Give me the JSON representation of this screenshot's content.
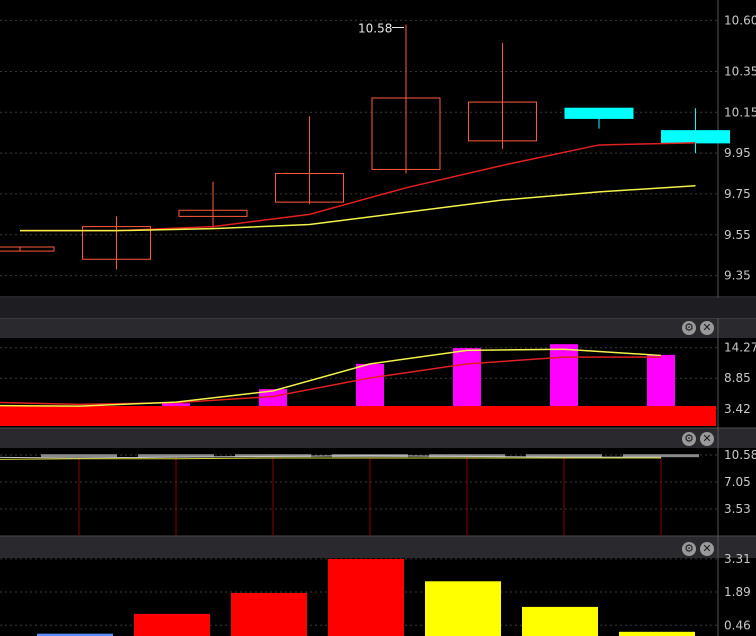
{
  "chart_data": [
    {
      "type": "candlestick",
      "ylim": [
        9.25,
        10.7
      ],
      "y_ticks": [
        "10.60",
        "10.35",
        "10.15",
        "9.95",
        "9.75",
        "9.55",
        "9.35"
      ],
      "y_tick_values": [
        10.6,
        10.35,
        10.15,
        9.95,
        9.75,
        9.55,
        9.35
      ],
      "candles": [
        {
          "open": 9.47,
          "close": 9.49,
          "high": 9.49,
          "low": 9.47,
          "color": "#ff5a3c",
          "filled": false
        },
        {
          "open": 9.43,
          "close": 9.59,
          "high": 9.64,
          "low": 9.38,
          "color": "#ff5a3c",
          "filled": false
        },
        {
          "open": 9.64,
          "close": 9.67,
          "high": 9.81,
          "low": 9.58,
          "color": "#ff5a3c",
          "filled": false
        },
        {
          "open": 9.71,
          "close": 9.85,
          "high": 10.13,
          "low": 9.7,
          "color": "#ff5a3c",
          "filled": false
        },
        {
          "open": 9.87,
          "close": 10.22,
          "high": 10.58,
          "low": 9.85,
          "color": "#ff5a3c",
          "filled": false
        },
        {
          "open": 10.01,
          "close": 10.2,
          "high": 10.49,
          "low": 9.97,
          "color": "#ff5a3c",
          "filled": false
        },
        {
          "open": 10.17,
          "close": 10.12,
          "high": 10.17,
          "low": 10.07,
          "color": "#00ffff",
          "filled": true
        },
        {
          "open": 10.06,
          "close": 10.0,
          "high": 10.17,
          "low": 9.95,
          "color": "#00ffff",
          "filled": true
        }
      ],
      "series": [
        {
          "color": "#e02020",
          "values": [
            9.57,
            9.57,
            9.59,
            9.65,
            9.78,
            9.89,
            9.99,
            10.0
          ]
        },
        {
          "color": "#f2f24a",
          "values": [
            9.57,
            9.57,
            9.58,
            9.6,
            9.66,
            9.72,
            9.76,
            9.79
          ]
        }
      ],
      "annotations": [
        {
          "text": "10.58",
          "at_candle": 4,
          "value": 10.58
        }
      ]
    },
    {
      "type": "bar",
      "ylim": [
        0,
        16
      ],
      "y_ticks": [
        "14.27",
        "8.85",
        "3.42"
      ],
      "y_tick_values": [
        14.27,
        8.85,
        3.42
      ],
      "values": [
        3.6,
        4.4,
        6.9,
        11.4,
        14.2,
        14.9,
        13.0
      ],
      "bar_color": "#ff00ff",
      "baseline_color": "#ff0000",
      "series": [
        {
          "color": "#e02020",
          "values": [
            4.6,
            4.2,
            4.5,
            5.6,
            8.9,
            11.4,
            12.6,
            12.6
          ]
        },
        {
          "color": "#f2f24a",
          "values": [
            4.0,
            3.9,
            4.6,
            6.6,
            11.4,
            13.8,
            14.0,
            12.9
          ]
        }
      ]
    },
    {
      "type": "bar",
      "ylim": [
        0,
        11.5
      ],
      "y_ticks": [
        "10.58",
        "7.05",
        "3.53"
      ],
      "y_tick_values": [
        10.58,
        7.05,
        3.53
      ],
      "values": [
        10.3,
        10.3,
        10.3,
        10.3,
        10.3,
        10.3,
        10.3
      ],
      "bar_color": "#8b0000",
      "cap_color": "#8a8a8a",
      "series": [
        {
          "color": "#c8c8c8",
          "values": [
            10.3,
            10.2,
            10.3,
            10.4,
            10.5,
            10.4,
            10.3,
            10.3
          ]
        },
        {
          "color": "#d2d23a",
          "values": [
            10.0,
            10.1,
            10.1,
            10.2,
            10.2,
            10.2,
            10.2,
            10.2
          ]
        }
      ]
    },
    {
      "type": "bar",
      "ylim": [
        0,
        3.35
      ],
      "y_ticks": [
        "3.31",
        "1.89",
        "0.46"
      ],
      "y_tick_values": [
        3.31,
        1.89,
        0.46
      ],
      "values": [
        0.1,
        0.95,
        1.85,
        3.31,
        2.35,
        1.25,
        0.18
      ],
      "bar_colors": [
        "#5a8fff",
        "#ff0000",
        "#ff0000",
        "#ff0000",
        "#ffff00",
        "#ffff00",
        "#ffff00"
      ]
    }
  ],
  "controls": {
    "settings_icon": "⚙",
    "close_icon": "✕"
  }
}
